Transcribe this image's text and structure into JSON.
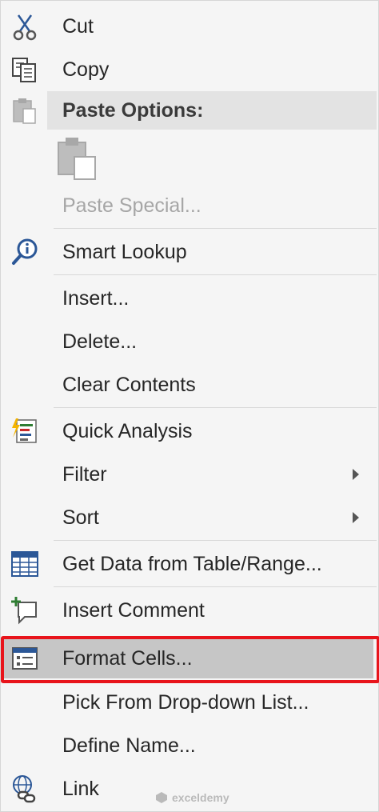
{
  "menu": {
    "items": [
      {
        "label": "Cut",
        "icon": "scissors-icon"
      },
      {
        "label": "Copy",
        "icon": "copy-icon"
      },
      {
        "label": "Paste Options:",
        "icon": "clipboard-icon"
      },
      {
        "label": "Paste Special...",
        "icon": "paste-icon"
      },
      {
        "label": "Smart Lookup",
        "icon": "smart-lookup-icon"
      },
      {
        "label": "Insert..."
      },
      {
        "label": "Delete..."
      },
      {
        "label": "Clear Contents"
      },
      {
        "label": "Quick Analysis",
        "icon": "quick-analysis-icon"
      },
      {
        "label": "Filter"
      },
      {
        "label": "Sort"
      },
      {
        "label": "Get Data from Table/Range...",
        "icon": "table-icon"
      },
      {
        "label": "Insert Comment",
        "icon": "comment-icon"
      },
      {
        "label": "Format Cells...",
        "icon": "format-cells-icon"
      },
      {
        "label": "Pick From Drop-down List..."
      },
      {
        "label": "Define Name..."
      },
      {
        "label": "Link",
        "icon": "link-icon"
      }
    ]
  },
  "colors": {
    "highlight_border": "#e8141b",
    "selected_background": "#c6c6c6",
    "header_background": "#e3e3e3",
    "disabled_text": "#a6a6a6"
  },
  "watermark": {
    "text": "exceldemy"
  }
}
